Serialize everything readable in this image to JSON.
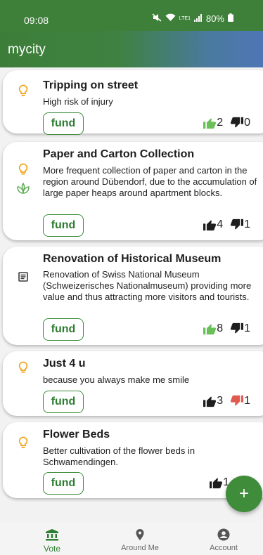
{
  "status": {
    "time": "09:08",
    "battery": "80%",
    "network": "LTE1"
  },
  "app": {
    "title": "mycity"
  },
  "colors": {
    "primary": "#3e7f3a",
    "up_active": "#6bbf59",
    "down_active": "#e05a4f",
    "neutral": "#1e1e1e"
  },
  "ideas": [
    {
      "title": "Tripping on street",
      "description": "High risk of injury",
      "fund_label": "fund",
      "up": "2",
      "down": "0",
      "icons": [
        "lightbulb-icon"
      ],
      "up_state": "active",
      "down_state": "neutral"
    },
    {
      "title": "Paper and Carton Collection",
      "description": "More frequent collection of paper and carton in the region around Dübendorf, due to the accumulation of large paper heaps around apartment blocks.",
      "fund_label": "fund",
      "up": "4",
      "down": "1",
      "icons": [
        "lightbulb-icon",
        "eco-leaf-icon"
      ],
      "up_state": "neutral",
      "down_state": "neutral"
    },
    {
      "title": "Renovation of Historical Museum",
      "description": "Renovation of Swiss National Museum (Schweizerisches Nationalmuseum) providing more value and thus attracting more visitors and tourists.",
      "fund_label": "fund",
      "up": "8",
      "down": "1",
      "icons": [
        "article-icon"
      ],
      "up_state": "active",
      "down_state": "neutral"
    },
    {
      "title": "Just 4 u",
      "description": "because you always make me smile",
      "fund_label": "fund",
      "up": "3",
      "down": "1",
      "icons": [
        "lightbulb-icon"
      ],
      "up_state": "neutral",
      "down_state": "active"
    },
    {
      "title": "Flower Beds",
      "description": "Better cultivation of the flower beds in Schwamendingen.",
      "fund_label": "fund",
      "up": "1",
      "down": "",
      "icons": [
        "lightbulb-icon"
      ],
      "up_state": "neutral",
      "down_state": "neutral"
    }
  ],
  "fab": {
    "label": "+"
  },
  "nav": [
    {
      "label": "Vote",
      "icon": "bank-icon",
      "active": true
    },
    {
      "label": "Around Me",
      "icon": "location-pin-icon",
      "active": false
    },
    {
      "label": "Account",
      "icon": "account-circle-icon",
      "active": false
    }
  ]
}
